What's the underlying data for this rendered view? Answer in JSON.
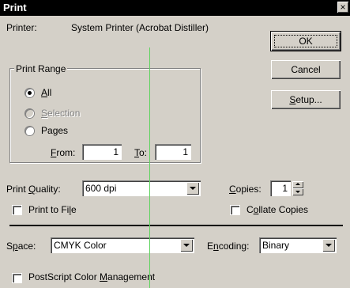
{
  "dialog": {
    "title": "Print",
    "close_glyph": "×"
  },
  "printer": {
    "label": "Printer:",
    "value": "System Printer (Acrobat Distiller)"
  },
  "buttons": {
    "ok": "OK",
    "cancel": "Cancel",
    "setup": "Setup..."
  },
  "print_range": {
    "group_label": "Print Range",
    "all": "All",
    "selection": "Selection",
    "pages": "Pages",
    "from_label": "From:",
    "from_value": "1",
    "to_label": "To:",
    "to_value": "1",
    "selected": "all"
  },
  "print_quality": {
    "label": "Print Quality:",
    "value": "600 dpi"
  },
  "copies": {
    "label": "Copies:",
    "value": "1"
  },
  "options": {
    "print_to_file": "Print to File",
    "collate_copies": "Collate Copies",
    "postscript_color_management": "PostScript Color Management"
  },
  "space": {
    "label": "Space:",
    "value": "CMYK Color"
  },
  "encoding": {
    "label": "Encoding:",
    "value": "Binary"
  },
  "icons": {
    "close": "close-icon",
    "dropdown": "chevron-down-icon",
    "spin": "spinner-arrows-icon"
  },
  "colors": {
    "title_bar": "#000000",
    "face": "#d4d0c8",
    "guide_line": "#5fd35f"
  }
}
